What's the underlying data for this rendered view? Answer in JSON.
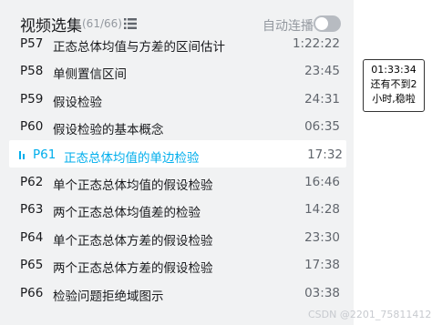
{
  "header": {
    "title": "视频选集",
    "count": "(61/66)",
    "autoplay_label": "自动连播",
    "list_icon": "list-icon"
  },
  "episodes": [
    {
      "ep": "P57",
      "title": "正态总体均值与方差的区间估计",
      "duration": "1:22:22"
    },
    {
      "ep": "P58",
      "title": "单侧置信区间",
      "duration": "23:45"
    },
    {
      "ep": "P59",
      "title": "假设检验",
      "duration": "24:31"
    },
    {
      "ep": "P60",
      "title": "假设检验的基本概念",
      "duration": "06:35"
    },
    {
      "ep": "P61",
      "title": "正态总体均值的单边检验",
      "duration": "17:32",
      "active": true
    },
    {
      "ep": "P62",
      "title": "单个正态总体均值的假设检验",
      "duration": "16:46"
    },
    {
      "ep": "P63",
      "title": "两个正态总体均值差的检验",
      "duration": "14:28"
    },
    {
      "ep": "P64",
      "title": "单个正态总体方差的假设检验",
      "duration": "23:30"
    },
    {
      "ep": "P65",
      "title": "两个正态总体方差的假设检验",
      "duration": "17:38"
    },
    {
      "ep": "P66",
      "title": "检验问题拒绝域图示",
      "duration": "03:38"
    }
  ],
  "colors": {
    "accent": "#00aeec",
    "panel_bg": "#f1f2f3"
  },
  "watermark": "CSDN @2201_75811412",
  "note": {
    "line1": "01:33:34",
    "line2": "还有不到2",
    "line3": "小时,稳啦"
  }
}
